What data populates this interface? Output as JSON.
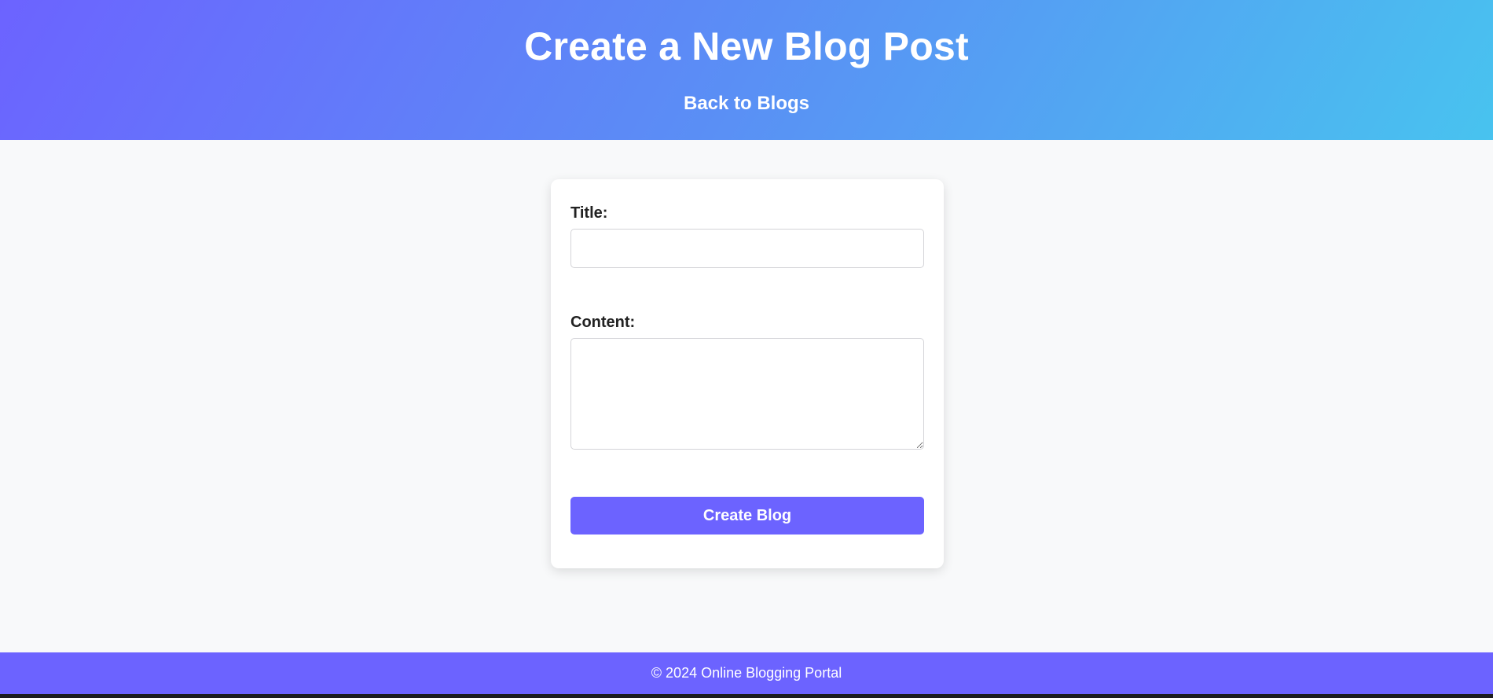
{
  "header": {
    "title": "Create a New Blog Post",
    "back_link": "Back to Blogs"
  },
  "form": {
    "title_label": "Title:",
    "title_value": "",
    "content_label": "Content:",
    "content_value": "",
    "submit_label": "Create Blog"
  },
  "footer": {
    "text": "© 2024 Online Blogging Portal"
  },
  "colors": {
    "accent": "#6c63ff",
    "gradient_start": "#6c63ff",
    "gradient_end": "#48c3ef",
    "page_background": "#f8f9fa"
  }
}
